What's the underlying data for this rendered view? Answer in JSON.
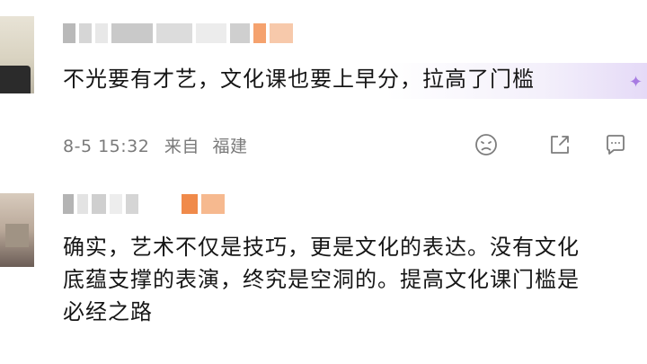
{
  "comments": [
    {
      "text_lines": [
        "不光要有才艺，文化课也要上早分，拉高了门槛"
      ],
      "time": "8-5 15:32",
      "from_label": "来自",
      "location": "福建",
      "actions": [
        {
          "icon": "emoji-icon"
        },
        {
          "icon": "share-icon"
        },
        {
          "icon": "comment-icon"
        }
      ]
    },
    {
      "text_lines": [
        "确实，艺术不仅是技巧，更是文化的表达。没有文化",
        "底蕴支撑的表演，终究是空洞的。提高文化课门槛是",
        "必经之路"
      ]
    }
  ],
  "colors": {
    "background": "#ffffff",
    "text": "#161616",
    "meta": "#7a7a7a",
    "mosaic_accent": "#f28c4e",
    "highlight": "#e2d6f6"
  }
}
